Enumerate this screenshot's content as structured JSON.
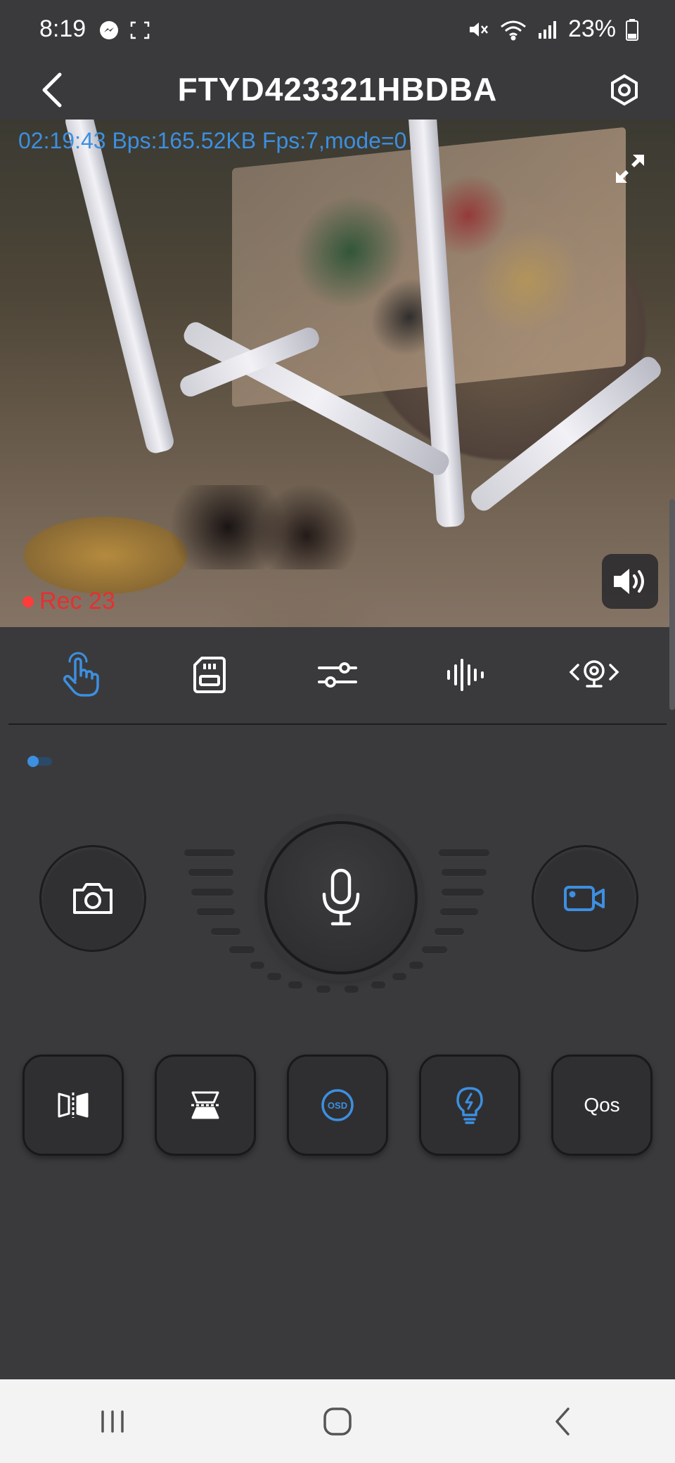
{
  "status_bar": {
    "time": "8:19",
    "battery": "23%"
  },
  "app_bar": {
    "title": "FTYD423321HBDBA"
  },
  "video": {
    "overlay": "02:19:43  Bps:165.52KB  Fps:7,mode=0",
    "rec_label": "Rec 23"
  },
  "toolbar": {
    "items": [
      "touch-control-icon",
      "sd-card-icon",
      "adjust-sliders-icon",
      "audio-wave-icon",
      "camera-rotate-icon"
    ]
  },
  "controls": {
    "snapshot": "camera-icon",
    "talk": "microphone-icon",
    "record": "video-camera-icon"
  },
  "features": {
    "osd_label": "OSD",
    "qos_label": "Qos"
  },
  "colors": {
    "accent": "#3d8fe0",
    "background": "#3a3a3c",
    "rec": "#e53030"
  }
}
